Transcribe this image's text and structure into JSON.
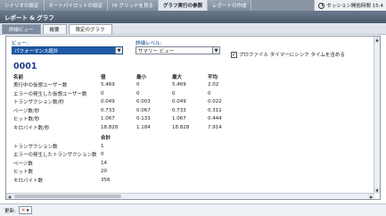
{
  "top_tabs": [
    "シナリオの設定",
    "オートパイロットの設定",
    "Hi グリッドを見る",
    "グラフ実行の参照",
    "レポートの作成"
  ],
  "session_tab": "セッション開始時間 15:4",
  "header_title": "レポート & グラフ",
  "sub_tabs": [
    "詳細ビュー",
    "概要",
    "限定のグラフ"
  ],
  "view_label": "ビュー:",
  "view_value": "パフォーマンス統計",
  "detail_label": "詳細レベル:",
  "detail_value": "サマリー ビュー",
  "profile_checkbox_label": "プロファイル タイマーにシンク タイムを含める",
  "profile_checked": true,
  "section_number": "0001",
  "table1": {
    "headers": [
      "名前",
      "値",
      "最小",
      "最大",
      "平均"
    ],
    "rows": [
      [
        "実行中の仮想ユーザー数",
        "5.469",
        "0",
        "5.469",
        "2.02"
      ],
      [
        "エラーの発生した仮想ユーザー数",
        "0",
        "0",
        "0",
        "0"
      ],
      [
        "トランザクション数/秒",
        "0.049",
        "0.003",
        "0.049",
        "0.022"
      ],
      [
        "ページ数/秒",
        "0.733",
        "0.067",
        "0.733",
        "0.311"
      ],
      [
        "ヒット数/秒",
        "1.067",
        "0.133",
        "1.067",
        "0.444"
      ],
      [
        "キロバイト数/秒",
        "18.828",
        "1.184",
        "18.828",
        "7.914"
      ]
    ]
  },
  "table2": {
    "header": "合計",
    "rows": [
      [
        "トランザクション数",
        "1"
      ],
      [
        "エラーの発生したトランザクション数",
        "0"
      ],
      [
        "ページ数",
        "14"
      ],
      [
        "ヒット数",
        "20"
      ],
      [
        "キロバイト数",
        "356"
      ]
    ]
  },
  "footer": {
    "label": "更新:"
  },
  "colors": {
    "accent": "#1e5aa8",
    "header_bg": "#5a6779",
    "section_number": "#1e3c8c"
  },
  "icons": {
    "session": "clock-icon",
    "dropdown": "chevron-down-icon",
    "refresh_cancel": "close-icon"
  }
}
